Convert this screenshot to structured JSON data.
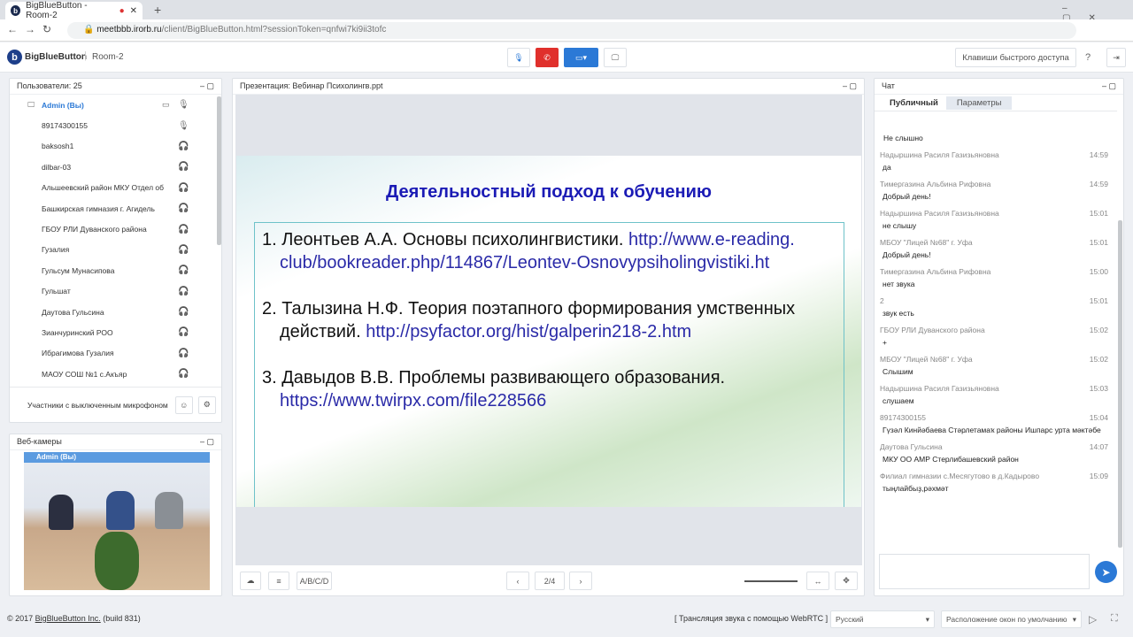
{
  "browser": {
    "tab_title": "BigBlueButton - Room-2",
    "url_host": "meetbbb.irorb.ru",
    "url_path": "/client/BigBlueButton.html?sessionToken=qnfwi7ki9ii3tofc"
  },
  "header": {
    "brand": "BigBlueButton",
    "room": "Room-2",
    "shortcuts": "Клавиши быстрого доступа"
  },
  "users": {
    "title": "Пользователи: 25",
    "list": [
      {
        "name": "Admin (Вы)",
        "icon": "microphone-icon"
      },
      {
        "name": "89174300155",
        "icon": "microphone-muted-icon"
      },
      {
        "name": "baksosh1",
        "icon": "headphones-icon"
      },
      {
        "name": "dilbar-03",
        "icon": "headphones-icon"
      },
      {
        "name": "Альшеевский район МКУ Отдел об",
        "icon": "headphones-icon"
      },
      {
        "name": "Башкирская гимназия г. Агидель",
        "icon": "headphones-icon"
      },
      {
        "name": "ГБОУ РЛИ Дуванского района",
        "icon": "headphones-icon"
      },
      {
        "name": "Гузалия",
        "icon": "headphones-icon"
      },
      {
        "name": "Гульсум Мунасипова",
        "icon": "headphones-icon"
      },
      {
        "name": "Гульшат",
        "icon": "headphones-icon"
      },
      {
        "name": "Даутова Гульсина",
        "icon": "headphones-icon"
      },
      {
        "name": "Зианчуринский РОО",
        "icon": "headphones-icon"
      },
      {
        "name": "Ибрагимова Гузалия",
        "icon": "headphones-icon"
      },
      {
        "name": "МАОУ СОШ №1 с.Акъяр",
        "icon": "headphones-icon"
      }
    ],
    "muted_label": "Участники с выключенным микрофоном"
  },
  "webcams": {
    "title": "Веб-камеры",
    "video_label": "Admin (Вы)"
  },
  "presentation": {
    "title": "Презентация: Вебинар Психолингв.ppt",
    "slide_title": "Деятельностный подход к обучению",
    "items": [
      {
        "text": "1. Леонтьев А.А. Основы психолингвистики. ",
        "link": "http://www.e-reading. club/bookreader.php/114867/Leontev-Osnovypsiholingvistiki.ht"
      },
      {
        "text": "2. Талызина Н.Ф. Теория поэтапного формирования умственных действий. ",
        "link": "http://psyfactor.org/hist/galperin218-2.htm"
      },
      {
        "text": "3. Давыдов В.В. Проблемы развивающего образования. ",
        "link": "https://www.twirpx.com/file228566"
      }
    ],
    "page": "2/4",
    "abcd": "A/B/C/D"
  },
  "chat": {
    "title": "Чат",
    "tabs": [
      "Публичный",
      "Параметры"
    ],
    "first": "Не слышно",
    "messages": [
      {
        "name": "Надыршина Расиля Газизьяновна",
        "time": "14:59",
        "text": "да"
      },
      {
        "name": "Тимергазина Альбина  Рифовна",
        "time": "14:59",
        "text": "Добрый день!"
      },
      {
        "name": "Надыршина Расиля Газизьяновна",
        "time": "15:01",
        "text": "не слышу"
      },
      {
        "name": "МБОУ \"Лицей №68\" г. Уфа",
        "time": "15:01",
        "text": "Добрый день!"
      },
      {
        "name": "Тимергазина Альбина  Рифовна",
        "time": "15:00",
        "text": "нет звука"
      },
      {
        "name": "2",
        "time": "15:01",
        "text": "звук есть"
      },
      {
        "name": "ГБОУ РЛИ Дуванского района",
        "time": "15:02",
        "text": "+"
      },
      {
        "name": "МБОУ \"Лицей №68\" г. Уфа",
        "time": "15:02",
        "text": "Слышим"
      },
      {
        "name": "Надыршина Расиля Газизьяновна",
        "time": "15:03",
        "text": "слушаем"
      },
      {
        "name": "89174300155",
        "time": "15:04",
        "text": "Гүзәл Кинйәбаева Стәрлетамаҡ районы Ишпарс урта мәктәбе"
      },
      {
        "name": "Даутова Гульсина",
        "time": "14:07",
        "text": "МКУ ОО АМР Стерлибашевский район"
      },
      {
        "name": "Филиал гимназии с.Месягутово в д.Кадырово",
        "time": "15:09",
        "text": "тыңлайбыҙ,рәхмәт"
      }
    ]
  },
  "footer": {
    "copyright": "© 2017 ",
    "company": "BigBlueButton Inc.",
    "build": " (build 831)",
    "webrtc": "[ Трансляция звука с помощью WebRTC ]",
    "language": "Русский",
    "layout": "Расположение окон по умолчанию"
  },
  "colors": {
    "accent": "#2b79d6",
    "hangup": "#e0302c",
    "slide_title": "#1b1bb5"
  }
}
